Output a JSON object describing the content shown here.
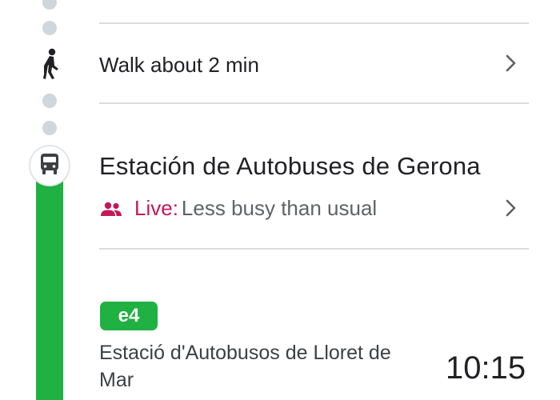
{
  "walk_step": {
    "label": "Walk about 2 min",
    "icon": "walk-icon"
  },
  "station": {
    "name": "Estación de Autobuses de Gerona",
    "icon": "bus-icon",
    "crowd": {
      "live_label": "Live:",
      "status": "Less busy than usual",
      "icon": "people-icon"
    }
  },
  "departure": {
    "route": "e4",
    "destination": "Estació d'Autobusos de Lloret de Mar",
    "time": "10:15"
  },
  "colors": {
    "route_green": "#1fb141",
    "live_magenta": "#c2185b",
    "timeline_dot": "#cfd6dc",
    "divider": "#dadce0"
  }
}
